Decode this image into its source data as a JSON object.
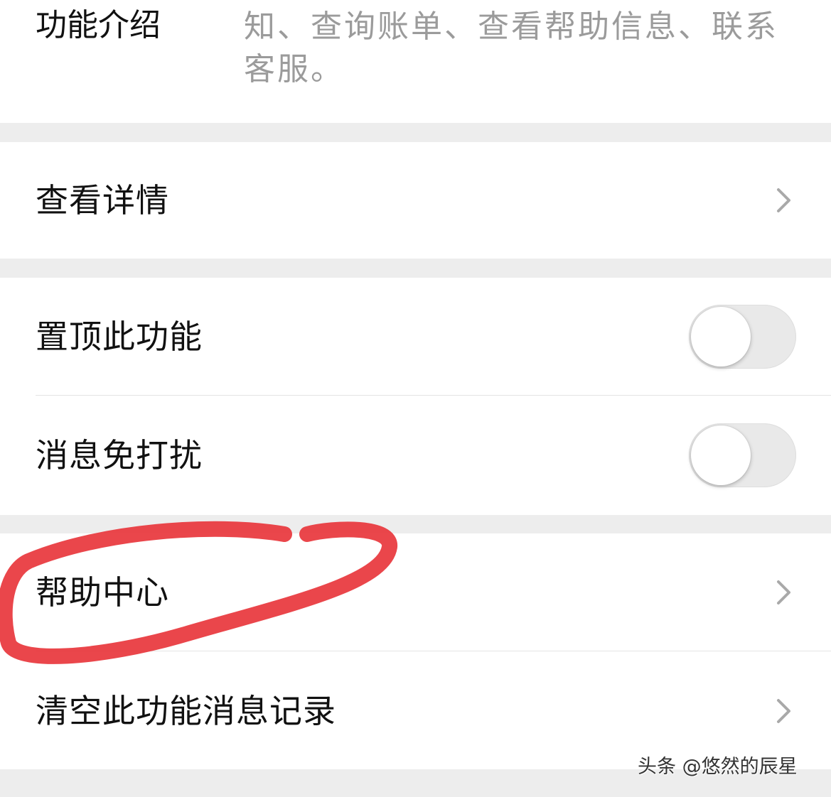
{
  "intro": {
    "label": "功能介绍",
    "description": "知、查询账单、查看帮助信息、联系客服。"
  },
  "details_row": {
    "label": "查看详情"
  },
  "toggles": [
    {
      "label": "置顶此功能",
      "enabled": false
    },
    {
      "label": "消息免打扰",
      "enabled": false
    }
  ],
  "actions": [
    {
      "label": "帮助中心",
      "highlighted": true
    },
    {
      "label": "清空此功能消息记录",
      "highlighted": false
    }
  ],
  "annotation": {
    "color": "#e8383d"
  },
  "watermark": {
    "text": "头条 @悠然的辰星"
  },
  "icons": {
    "chevron": "chevron-right-icon"
  },
  "colors": {
    "background": "#ededed",
    "card": "#ffffff",
    "primary_text": "#111111",
    "secondary_text": "#9b9b9b",
    "chevron": "#a9a9a9",
    "toggle_off": "#e9e9e9"
  }
}
